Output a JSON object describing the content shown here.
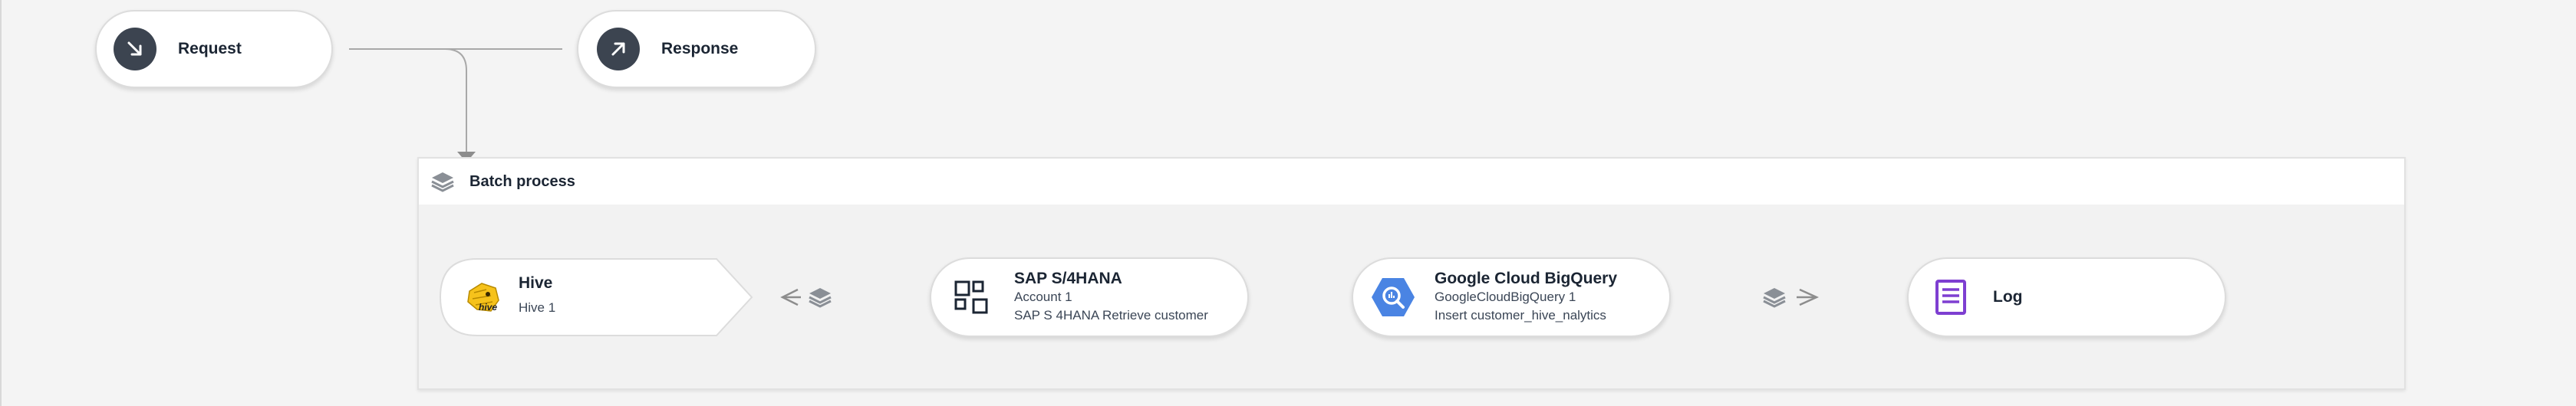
{
  "trigger": {
    "request_label": "Request",
    "response_label": "Response"
  },
  "batch": {
    "title": "Batch process"
  },
  "nodes": {
    "hive": {
      "title": "Hive",
      "subtitle": "Hive 1",
      "icon": "hive-bee-icon",
      "logo_text": "hive"
    },
    "sap": {
      "title": "SAP S/4HANA",
      "account": "Account 1",
      "operation": "SAP S 4HANA Retrieve customer",
      "icon": "sap-grid-icon"
    },
    "bigquery": {
      "title": "Google Cloud BigQuery",
      "account": "GoogleCloudBigQuery 1",
      "operation": "Insert customer_hive_nalytics",
      "icon": "bigquery-icon"
    },
    "log": {
      "title": "Log",
      "icon": "log-document-icon"
    }
  },
  "colors": {
    "background": "#f4f4f4",
    "dark_icon": "#3c4450",
    "bigquery_blue": "#4a84e3",
    "log_purple": "#7e3fd1",
    "hive_yellow": "#f6c21b",
    "connector": "#9a9a9a"
  }
}
